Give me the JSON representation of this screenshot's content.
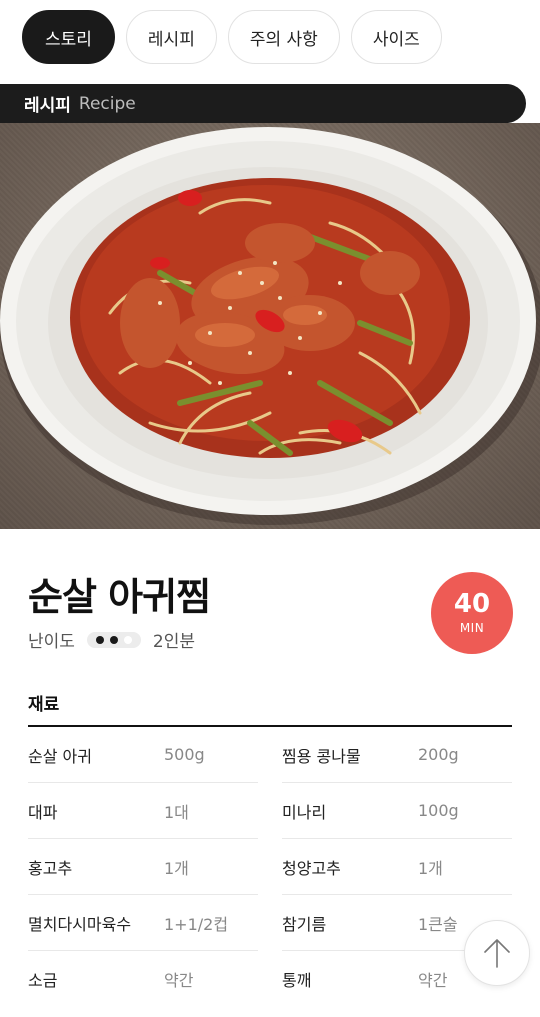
{
  "tabs": [
    {
      "label": "스토리",
      "active": true
    },
    {
      "label": "레시피",
      "active": false
    },
    {
      "label": "주의 사항",
      "active": false
    },
    {
      "label": "사이즈",
      "active": false
    }
  ],
  "section": {
    "ko": "레시피",
    "en": "Recipe"
  },
  "hero": {
    "icon": "braised-monkfish-photo"
  },
  "recipe": {
    "title": "순살 아귀찜",
    "difficulty_label": "난이도",
    "difficulty_level": 2,
    "difficulty_max": 3,
    "servings": "2인분",
    "time_value": "40",
    "time_unit": "MIN"
  },
  "ingredients": {
    "title": "재료",
    "rows": [
      [
        {
          "name": "순살 아귀",
          "amount": "500g"
        },
        {
          "name": "찜용 콩나물",
          "amount": "200g"
        }
      ],
      [
        {
          "name": "대파",
          "amount": "1대"
        },
        {
          "name": "미나리",
          "amount": "100g"
        }
      ],
      [
        {
          "name": "홍고추",
          "amount": "1개"
        },
        {
          "name": "청양고추",
          "amount": "1개"
        }
      ],
      [
        {
          "name": "멸치다시마육수",
          "amount": "1+1/2컵"
        },
        {
          "name": "참기름",
          "amount": "1큰술"
        }
      ],
      [
        {
          "name": "소금",
          "amount": "약간"
        },
        {
          "name": "통깨",
          "amount": "약간"
        }
      ]
    ]
  },
  "colors": {
    "accent": "#ee5b55",
    "dark": "#1c1c1c"
  },
  "scroll_top": {
    "icon": "arrow-up-icon"
  }
}
